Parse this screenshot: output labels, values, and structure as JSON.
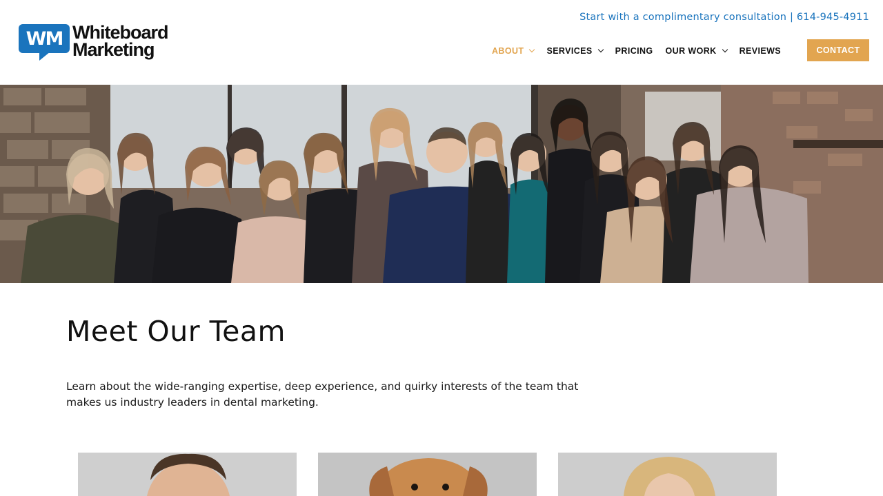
{
  "brand": {
    "logo_mark": "WM",
    "logo_line1": "Whiteboard",
    "logo_line2": "Marketing",
    "colors": {
      "primary_blue": "#1a74bd",
      "accent_orange": "#e2a550",
      "text_dark": "#111111"
    }
  },
  "header": {
    "consultation_text": "Start with a complimentary consultation | 614-945-4911",
    "nav": [
      {
        "label": "ABOUT",
        "has_dropdown": true,
        "active": true
      },
      {
        "label": "SERVICES",
        "has_dropdown": true,
        "active": false
      },
      {
        "label": "PRICING",
        "has_dropdown": false,
        "active": false
      },
      {
        "label": "OUR WORK",
        "has_dropdown": true,
        "active": false
      },
      {
        "label": "REVIEWS",
        "has_dropdown": false,
        "active": false
      }
    ],
    "contact_label": "CONTACT"
  },
  "hero": {
    "image_description_icon": "team-photo"
  },
  "main": {
    "title": "Meet Our Team",
    "intro": "Learn about the wide-ranging expertise, deep experience, and quirky interests of the team that makes us industry leaders in dental marketing.",
    "team_cards": [
      {
        "photo": "man-portrait"
      },
      {
        "photo": "dog-portrait"
      },
      {
        "photo": "woman-portrait"
      }
    ]
  }
}
